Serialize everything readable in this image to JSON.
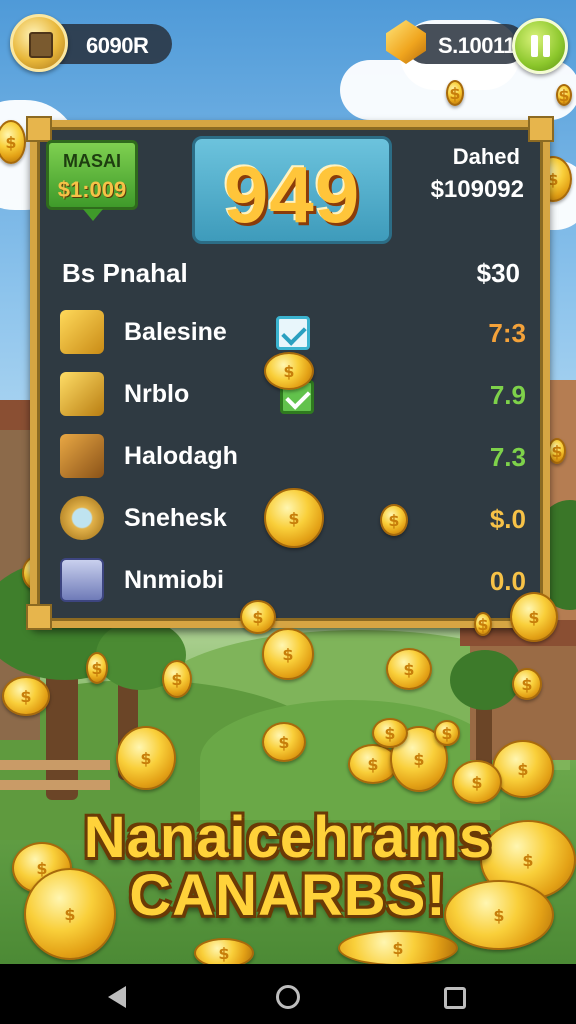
{
  "hud": {
    "wallet_label": "6090R",
    "cash_label": "S.10011"
  },
  "panel": {
    "badge_title": "MASAI",
    "badge_value": "$1:009",
    "score": "949",
    "top_right_label": "Dahed",
    "top_right_value": "$109092",
    "header_label": "Bs Pnahal",
    "header_value": "$30",
    "rows": [
      {
        "label": "Balesine",
        "value": "7:3",
        "color": "#f4a23a",
        "icon": "gold-bars-icon"
      },
      {
        "label": "Nrblo",
        "value": "7.9",
        "color": "#7ed24a",
        "icon": "gold-crates-icon"
      },
      {
        "label": "Halodagh",
        "value": "7.3",
        "color": "#7ed24a",
        "icon": "treasure-chest-icon"
      },
      {
        "label": "Snehesk",
        "value": "$.0",
        "color": "#f7c247",
        "icon": "gear-icon"
      },
      {
        "label": "Nnmiobi",
        "value": "0.0",
        "color": "#f7c247",
        "icon": "vault-icon"
      }
    ]
  },
  "banner": {
    "line1": "Nanaicehrams",
    "line2": "CANARBS!"
  },
  "navbar": {
    "back_icon": "back-icon",
    "home_icon": "home-icon",
    "recents_icon": "recents-icon"
  }
}
